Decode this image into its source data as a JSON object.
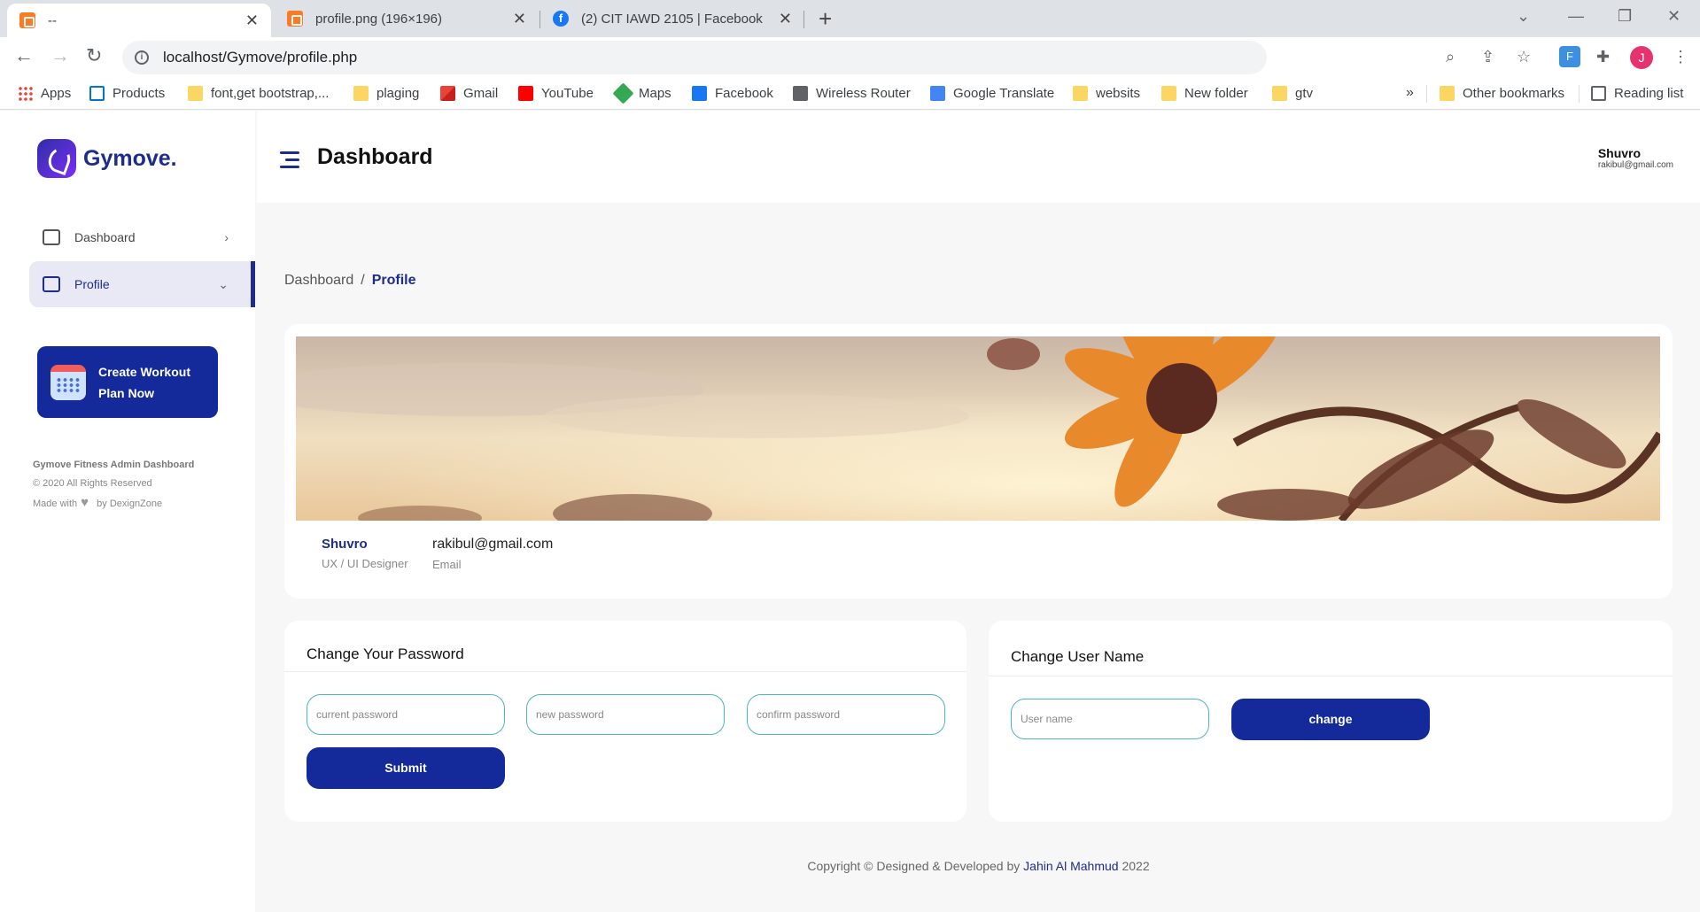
{
  "browser": {
    "tabs": [
      {
        "title": "--",
        "favicon": "xampp-icon",
        "active": true
      },
      {
        "title": "profile.png (196×196)",
        "favicon": "xampp-icon",
        "active": false
      },
      {
        "title": "(2) CIT IAWD 2105 | Facebook",
        "favicon": "facebook-icon",
        "active": false
      }
    ],
    "url": "localhost/Gymove/profile.php",
    "profile_initial": "J",
    "bookmarks": [
      {
        "label": "Apps",
        "icon": "apps-icon"
      },
      {
        "label": "Products",
        "icon": "dell-icon"
      },
      {
        "label": "font,get bootstrap,...",
        "icon": "folder-icon"
      },
      {
        "label": "plaging",
        "icon": "folder-icon"
      },
      {
        "label": "Gmail",
        "icon": "gmail-icon"
      },
      {
        "label": "YouTube",
        "icon": "youtube-icon"
      },
      {
        "label": "Maps",
        "icon": "maps-icon"
      },
      {
        "label": "Facebook",
        "icon": "facebook-icon"
      },
      {
        "label": "Wireless Router",
        "icon": "globe-icon"
      },
      {
        "label": "Google Translate",
        "icon": "translate-icon"
      },
      {
        "label": "websits",
        "icon": "folder-icon"
      },
      {
        "label": "New folder",
        "icon": "folder-icon"
      },
      {
        "label": "gtv",
        "icon": "folder-icon"
      }
    ],
    "more": "»",
    "other_bookmarks": "Other bookmarks",
    "reading_list": "Reading list"
  },
  "brand": {
    "name": "Gymove",
    "dot": "."
  },
  "sidebar": {
    "items": [
      {
        "label": "Dashboard",
        "icon": "dashboard-icon",
        "active": false
      },
      {
        "label": "Profile",
        "icon": "monitor-icon",
        "active": true
      }
    ],
    "cta": {
      "line1": "Create Workout",
      "line2": "Plan Now",
      "icon": "calendar-icon"
    },
    "footer": {
      "title": "Gymove Fitness Admin Dashboard",
      "rights": "© 2020 All Rights Reserved",
      "made_prefix": "Made with",
      "made_suffix": "by DexignZone"
    }
  },
  "header": {
    "title": "Dashboard",
    "user_name": "Shuvro",
    "user_email": "rakibul@gmail.com"
  },
  "breadcrumb": {
    "parent": "Dashboard",
    "separator": "/",
    "current": "Profile"
  },
  "profile": {
    "name": "Shuvro",
    "role": "UX / UI Designer",
    "email": "rakibul@gmail.com",
    "email_label": "Email"
  },
  "password_form": {
    "title": "Change Your Password",
    "current_placeholder": "current password",
    "new_placeholder": "new password",
    "confirm_placeholder": "confirm password",
    "submit_label": "Submit"
  },
  "username_form": {
    "title": "Change User Name",
    "username_placeholder": "User name",
    "change_label": "change"
  },
  "footer": {
    "prefix": "Copyright © Designed & Developed by",
    "author": "Jahin Al Mahmud",
    "year": "2022"
  },
  "colors": {
    "primary": "#14299a",
    "accent_text": "#1e2c8c",
    "input_border": "#4db6bf"
  }
}
